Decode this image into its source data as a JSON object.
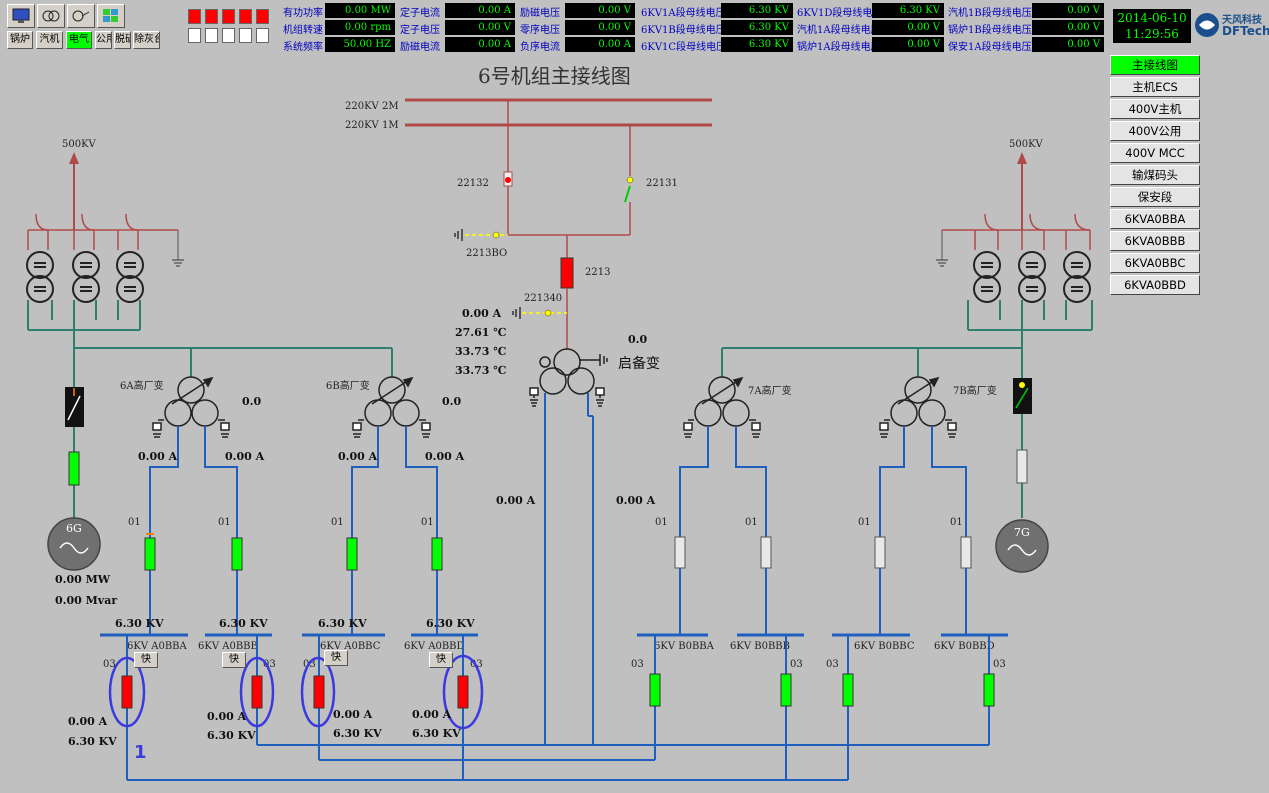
{
  "toolbar": {
    "icons": [
      "monitor-icon",
      "printer-icon",
      "hand-pointer-icon",
      "grid-icon"
    ],
    "buttons": [
      {
        "label": "锅炉",
        "active": false
      },
      {
        "label": "汽机",
        "active": false
      },
      {
        "label": "电气",
        "active": true
      },
      {
        "label": "公用",
        "active": false
      },
      {
        "label": "脱硫",
        "active": false
      },
      {
        "label": "除灰台",
        "active": false
      }
    ]
  },
  "indicators": {
    "red": 5,
    "white": 5
  },
  "measurements": [
    {
      "label": "有功功率",
      "value": "0.00 MW"
    },
    {
      "label": "机组转速",
      "value": "0.00 rpm"
    },
    {
      "label": "系统频率",
      "value": "50.00 HZ"
    },
    {
      "label": "定子电流",
      "value": "0.00 A"
    },
    {
      "label": "定子电压",
      "value": "0.00 V"
    },
    {
      "label": "励磁电流",
      "value": "0.00 A"
    },
    {
      "label": "励磁电压",
      "value": "0.00 V"
    },
    {
      "label": "零序电压",
      "value": "0.00 V"
    },
    {
      "label": "负序电流",
      "value": "0.00 A"
    },
    {
      "label": "6KV1A段母线电压",
      "value": "6.30 KV"
    },
    {
      "label": "6KV1B段母线电压",
      "value": "6.30 KV"
    },
    {
      "label": "6KV1C段母线电压",
      "value": "6.30 KV"
    },
    {
      "label": "6KV1D段母线电压",
      "value": "6.30 KV"
    },
    {
      "label": "汽机1A段母线电压",
      "value": "0.00 V"
    },
    {
      "label": "锅炉1A段母线电压",
      "value": "0.00 V"
    },
    {
      "label": "汽机1B段母线电压",
      "value": "0.00 V"
    },
    {
      "label": "锅炉1B段母线电压",
      "value": "0.00 V"
    },
    {
      "label": "保安1A段母线电压",
      "value": "0.00 V"
    }
  ],
  "clock": {
    "date": "2014-06-10",
    "time": "11:29:56"
  },
  "logo": {
    "cn": "天风科技",
    "en": "DFTech"
  },
  "page_title": "6号机组主接线图",
  "nav": [
    {
      "label": "主接线图",
      "active": true
    },
    {
      "label": "主机ECS",
      "active": false
    },
    {
      "label": "400V主机",
      "active": false
    },
    {
      "label": "400V公用",
      "active": false
    },
    {
      "label": "400V MCC",
      "active": false
    },
    {
      "label": "输煤码头",
      "active": false
    },
    {
      "label": "保安段",
      "active": false
    },
    {
      "label": "6KVA0BBA",
      "active": false
    },
    {
      "label": "6KVA0BBB",
      "active": false
    },
    {
      "label": "6KVA0BBC",
      "active": false
    },
    {
      "label": "6KVA0BBD",
      "active": false
    }
  ],
  "diagram": {
    "bus_220_2": "220KV 2M",
    "bus_220_1": "220KV 1M",
    "left_500": "500KV",
    "right_500": "500KV",
    "sw_22132": "22132",
    "sw_22131": "22131",
    "sw_2213BO": "2213BO",
    "brk_2213": "2213",
    "sw_221340": "221340",
    "startup_current": "0.00 A",
    "startup_temp1": "27.61 ℃",
    "startup_temp2": "33.73 ℃",
    "startup_temp3": "33.73 ℃",
    "startup_value": "0.0",
    "startup_name": "启备变",
    "t6a_name": "6A高厂变",
    "t6a_value": "0.0",
    "t6b_name": "6B高厂变",
    "t6b_value": "0.0",
    "t7a_name": "7A高厂变",
    "t7b_name": "7B高厂变",
    "gen6": "6G",
    "gen7": "7G",
    "gen6_mw": "0.00 MW",
    "gen6_mvar": "0.00 Mvar",
    "current_a1": "0.00 A",
    "current_a2": "0.00 A",
    "current_b1": "0.00 A",
    "current_b2": "0.00 A",
    "current_startup_left": "0.00 A",
    "current_startup_right": "0.00 A",
    "brk_01": "01",
    "brk_03": "03",
    "bus_v_a": "6.30 KV",
    "bus_v_b": "6.30 KV",
    "bus_v_c": "6.30 KV",
    "bus_v_d": "6.30 KV",
    "bus_a0bba": "6KV A0BBA",
    "bus_a0bbb": "6KV A0BBB",
    "bus_a0bbc": "6KV A0BBC",
    "bus_a0bbd": "6KV A0BBD",
    "bus_b0bba": "6KV B0BBA",
    "bus_b0bbb": "6KV B0BBB",
    "bus_b0bbc": "6KV B0BBC",
    "bus_b0bbd": "6KV B0BBD",
    "fast_label": "快",
    "feed_a_current": "0.00 A",
    "feed_a_voltage": "6.30 KV",
    "feed_b_current": "0.00 A",
    "feed_b_voltage": "6.30 KV",
    "feed_c_current": "0.00 A",
    "feed_c_voltage": "6.30 KV",
    "feed_d_current": "0.00 A",
    "feed_d_voltage": "6.30 KV",
    "annotation": "1"
  },
  "colors": {
    "transmission": "#b04a4a",
    "teal": "#2f7f6f",
    "blue": "#1f5fbf",
    "breaker_red": "#ff0000",
    "breaker_green": "#00ff00",
    "highlight_ring": "#3a3adf"
  }
}
